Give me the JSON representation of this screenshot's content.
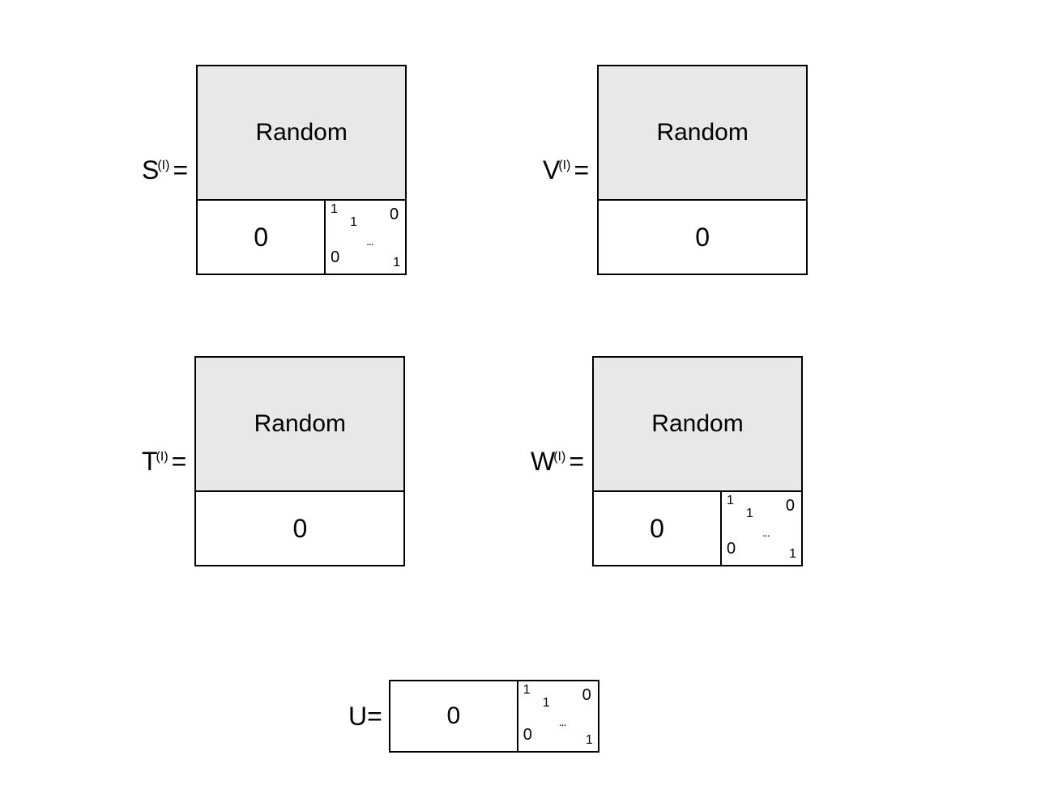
{
  "matrices": {
    "S": {
      "label": "S",
      "superscript": "(I)",
      "eq": "=",
      "top_label": "Random",
      "bottom_left_label": "0",
      "identity": {
        "tl": "1",
        "d1": "1",
        "tr": "0",
        "bl": "0",
        "dots": "...",
        "br": "1"
      }
    },
    "V": {
      "label": "V",
      "superscript": "(I)",
      "eq": "=",
      "top_label": "Random",
      "bottom_label": "0"
    },
    "T": {
      "label": "T",
      "superscript": "(I)",
      "eq": "=",
      "top_label": "Random",
      "bottom_label": "0"
    },
    "W": {
      "label": "W",
      "superscript": "(I)",
      "eq": "=",
      "top_label": "Random",
      "bottom_left_label": "0",
      "identity": {
        "tl": "1",
        "d1": "1",
        "tr": "0",
        "bl": "0",
        "dots": "...",
        "br": "1"
      }
    },
    "U": {
      "label": "U",
      "eq": " = ",
      "left_label": "0",
      "identity": {
        "tl": "1",
        "d1": "1",
        "tr": "0",
        "bl": "0",
        "dots": "...",
        "br": "1"
      }
    }
  }
}
